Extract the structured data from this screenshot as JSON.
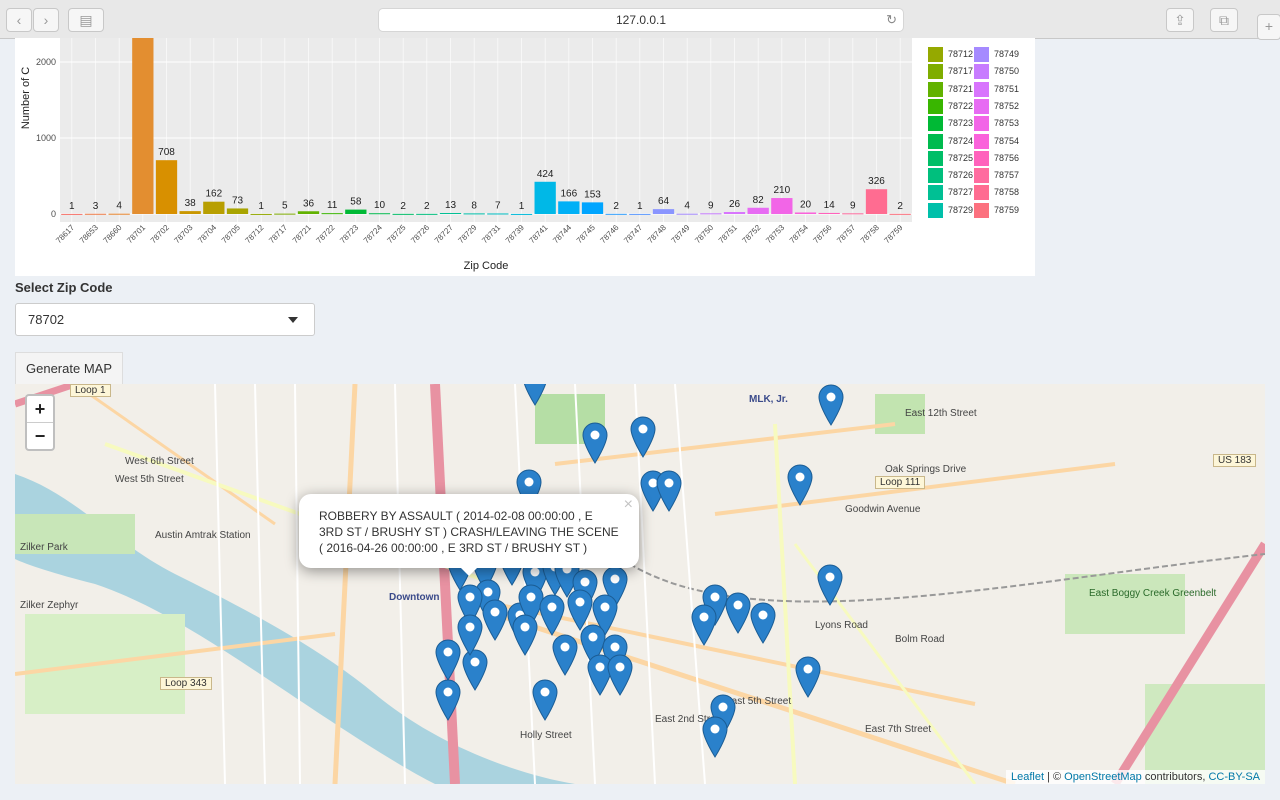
{
  "browser": {
    "url": "127.0.0.1"
  },
  "chart_data": {
    "type": "bar",
    "xlabel": "Zip Code",
    "ylabel": "Number of C",
    "yticks": [
      0,
      1000,
      2000
    ],
    "ylim": [
      0,
      2560
    ],
    "categories": [
      "78617",
      "78653",
      "78660",
      "78701",
      "78702",
      "78703",
      "78704",
      "78705",
      "78712",
      "78717",
      "78721",
      "78722",
      "78723",
      "78724",
      "78725",
      "78726",
      "78727",
      "78729",
      "78731",
      "78739",
      "78741",
      "78744",
      "78745",
      "78746",
      "78747",
      "78748",
      "78749",
      "78750",
      "78751",
      "78752",
      "78753",
      "78754",
      "78756",
      "78757",
      "78758",
      "78759"
    ],
    "values": [
      1,
      3,
      4,
      2560,
      708,
      38,
      162,
      73,
      1,
      5,
      36,
      11,
      58,
      10,
      2,
      2,
      13,
      8,
      7,
      1,
      424,
      166,
      153,
      2,
      1,
      64,
      4,
      9,
      26,
      82,
      210,
      20,
      14,
      9,
      326,
      2
    ],
    "labels": [
      "1",
      "3",
      "4",
      "",
      "708",
      "38",
      "162",
      "73",
      "1",
      "5",
      "36",
      "11",
      "58",
      "10",
      "2",
      "2",
      "13",
      "8",
      "7",
      "1",
      "424",
      "166",
      "153",
      "2",
      "1",
      "64",
      "4",
      "9",
      "26",
      "82",
      "210",
      "20",
      "14",
      "9",
      "326",
      "2"
    ],
    "colors": [
      "#f8766d",
      "#f07e4a",
      "#e9852c",
      "#e38e30",
      "#d89000",
      "#c99700",
      "#b89f00",
      "#a8a400",
      "#95a900",
      "#7fad00",
      "#62b200",
      "#39b600",
      "#00b935",
      "#00bb4e",
      "#00be67",
      "#00bf7d",
      "#00c094",
      "#00c0aa",
      "#00bfc4",
      "#00bbdb",
      "#00b8e7",
      "#00b0f6",
      "#00a5ff",
      "#35a2ff",
      "#619cff",
      "#8a95ff",
      "#a58aff",
      "#c77cff",
      "#d874fd",
      "#e76bf3",
      "#f265e7",
      "#fa62db",
      "#ff62bc",
      "#ff6c9f",
      "#ff6c91",
      "#fc717f"
    ]
  },
  "legend": {
    "col1": [
      {
        "label": "78712",
        "color": "#95a900"
      },
      {
        "label": "78717",
        "color": "#7fad00"
      },
      {
        "label": "78721",
        "color": "#62b200"
      },
      {
        "label": "78722",
        "color": "#39b600"
      },
      {
        "label": "78723",
        "color": "#00b935"
      },
      {
        "label": "78724",
        "color": "#00bb4e"
      },
      {
        "label": "78725",
        "color": "#00be67"
      },
      {
        "label": "78726",
        "color": "#00bf7d"
      },
      {
        "label": "78727",
        "color": "#00c094"
      },
      {
        "label": "78729",
        "color": "#00c0aa"
      }
    ],
    "col2": [
      {
        "label": "78749",
        "color": "#a58aff"
      },
      {
        "label": "78750",
        "color": "#c77cff"
      },
      {
        "label": "78751",
        "color": "#d874fd"
      },
      {
        "label": "78752",
        "color": "#e76bf3"
      },
      {
        "label": "78753",
        "color": "#f265e7"
      },
      {
        "label": "78754",
        "color": "#fa62db"
      },
      {
        "label": "78756",
        "color": "#ff62bc"
      },
      {
        "label": "78757",
        "color": "#ff6c9f"
      },
      {
        "label": "78758",
        "color": "#ff6c91"
      },
      {
        "label": "78759",
        "color": "#fc717f"
      }
    ]
  },
  "controls": {
    "select_label": "Select Zip Code",
    "selected_zip": "78702",
    "generate_button": "Generate MAP"
  },
  "map": {
    "popup_text": "ROBBERY BY ASSAULT ( 2014-02-08 00:00:00 , E 3RD ST / BRUSHY ST ) CRASH/LEAVING THE SCENE ( 2016-04-26 00:00:00 , E 3RD ST / BRUSHY ST )",
    "zoom_in": "+",
    "zoom_out": "−",
    "attribution_leaflet": "Leaflet",
    "attribution_mid": " | © ",
    "attribution_osm": "OpenStreetMap",
    "attribution_contrib": " contributors, ",
    "attribution_license": "CC-BY-SA",
    "labels": [
      "Austin Amtrak Station",
      "Zilker Park",
      "Zilker Zephyr",
      "Downtown",
      "MLK, Jr.",
      "East 12th Street",
      "Oak Springs Drive",
      "Goodwin Avenue",
      "Loop 111",
      "US 183",
      "East Boggy Creek Greenbelt",
      "Loop 343",
      "West 6th Street",
      "West 5th Street",
      "East 7th Street",
      "East 5th Street",
      "East 2nd Street",
      "Holly Street",
      "Lyons Road",
      "Bolm Road",
      "Loop 1"
    ]
  }
}
